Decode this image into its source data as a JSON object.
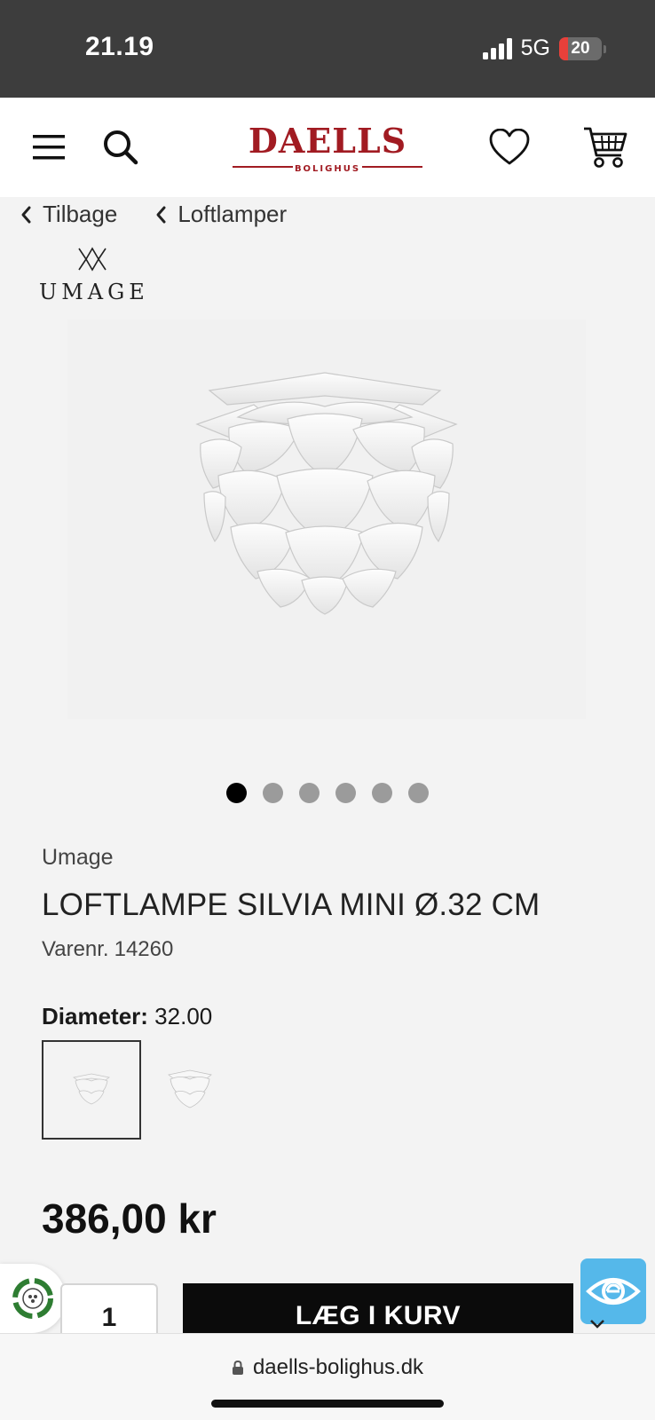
{
  "status_bar": {
    "time": "21.19",
    "network": "5G",
    "battery": "20",
    "battery_level": 0.2
  },
  "header": {
    "brand": "DAELLS",
    "brand_sub": "BOLIGHUS",
    "icons": [
      "menu-icon",
      "search-icon",
      "heart-icon",
      "cart-icon"
    ]
  },
  "breadcrumbs": [
    {
      "label": "Tilbage"
    },
    {
      "label": "Loftlamper"
    }
  ],
  "brand_logo": {
    "text": "UMAGE"
  },
  "gallery": {
    "count": 6,
    "active_index": 0
  },
  "product": {
    "brand": "Umage",
    "title": "LOFTLAMPE SILVIA MINI Ø.32 CM",
    "sku_label": "Varenr.",
    "sku": "14260",
    "variant_label": "Diameter:",
    "variant_value": "32.00",
    "price": "386,00 kr"
  },
  "cart": {
    "quantity": "1",
    "add_label": "LÆG I KURV"
  },
  "browser": {
    "url": "daells-bolighus.dk"
  },
  "colors": {
    "brand_red": "#a11b22",
    "emaerket_blue": "#55b8ea",
    "eco_green": "#2e7d32"
  }
}
